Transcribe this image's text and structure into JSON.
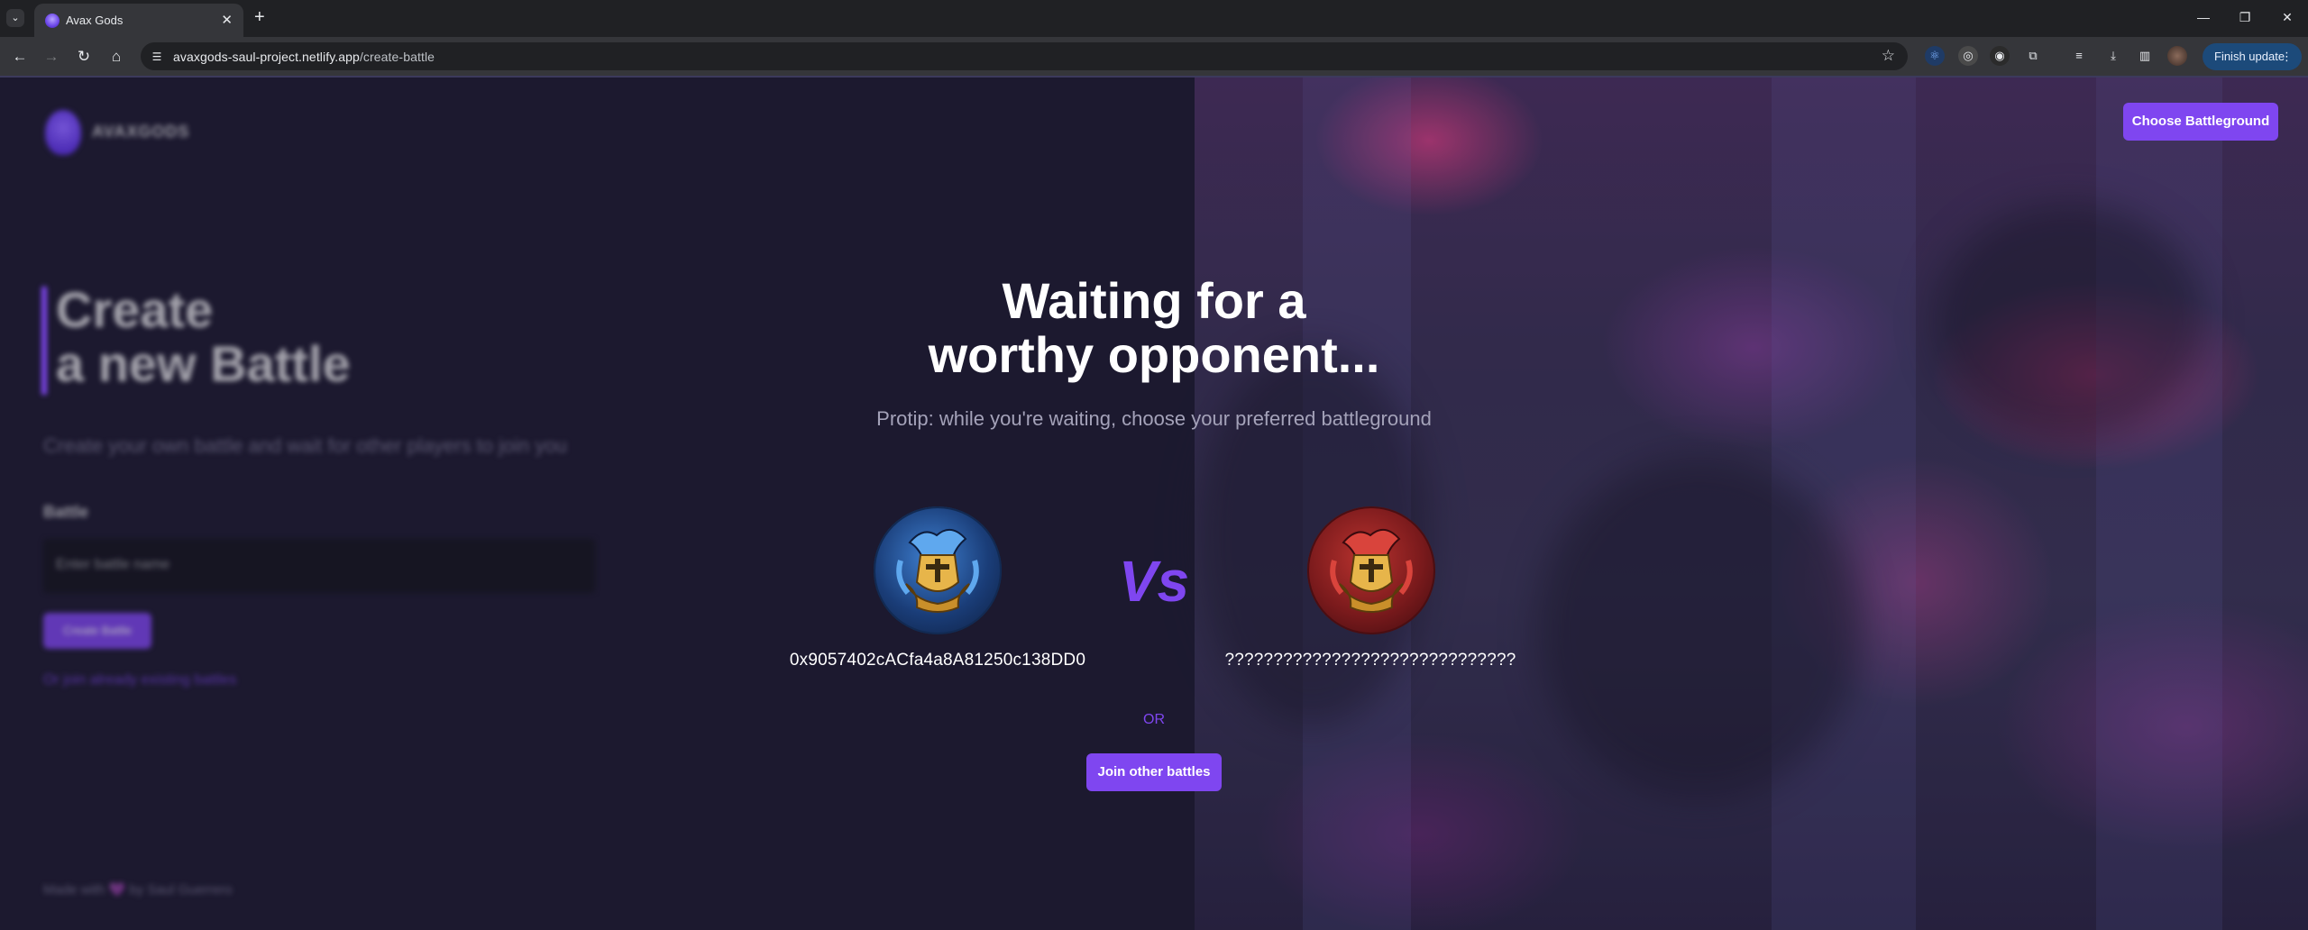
{
  "browser": {
    "tab_title": "Avax Gods",
    "url_host": "avaxgods-saul-project.netlify.app",
    "url_path": "/create-battle",
    "finish_update_label": "Finish update"
  },
  "page": {
    "logo_text": "AVAXGODS",
    "left_panel": {
      "title_line1": "Create",
      "title_line2": "a new Battle",
      "subtitle": "Create your own battle and wait for other players to join you",
      "input_label": "Battle",
      "input_placeholder": "Enter battle name",
      "create_button": "Create Battle",
      "join_link": "Or join already existing battles",
      "footer": "Made with 💜 by Saul Guerrero"
    },
    "choose_battleground_button": "Choose Battleground",
    "headline_line1": "Waiting for a",
    "headline_line2": "worthy opponent...",
    "protip": "Protip: while you're waiting, choose your preferred battleground",
    "player1_address": "0x9057402cACfa4a8A81250c138DD0",
    "player2_address": "??????????????????????????????",
    "vs_label": "Vs",
    "or_label": "OR",
    "join_button": "Join other battles"
  }
}
